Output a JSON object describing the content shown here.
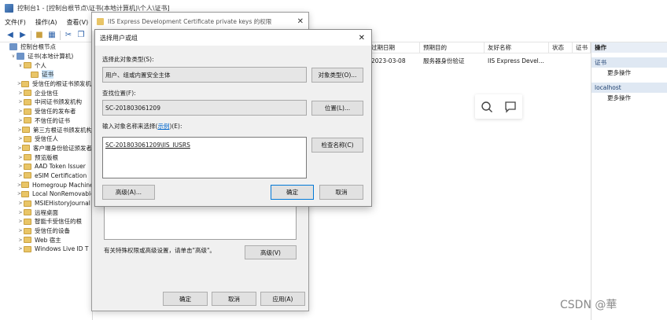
{
  "mmc": {
    "title": "控制台1 - [控制台根节点\\证书(本地计算机)\\个人\\证书]",
    "menu": [
      "文件(F)",
      "操作(A)",
      "查看(V)"
    ],
    "tree": [
      {
        "label": "控制台根节点",
        "indent": 0,
        "icon": "root",
        "exp": ""
      },
      {
        "label": "证书(本地计算机)",
        "indent": 1,
        "icon": "root",
        "exp": "∨"
      },
      {
        "label": "个人",
        "indent": 2,
        "icon": "folder",
        "exp": "∨"
      },
      {
        "label": "证书",
        "indent": 3,
        "icon": "folder",
        "exp": "",
        "selected": true
      },
      {
        "label": "受信任的根证书颁发机构",
        "indent": 2,
        "icon": "folder",
        "exp": ">"
      },
      {
        "label": "企业信任",
        "indent": 2,
        "icon": "folder",
        "exp": ">"
      },
      {
        "label": "中间证书颁发机构",
        "indent": 2,
        "icon": "folder",
        "exp": ">"
      },
      {
        "label": "受信任的发布者",
        "indent": 2,
        "icon": "folder",
        "exp": ">"
      },
      {
        "label": "不信任的证书",
        "indent": 2,
        "icon": "folder",
        "exp": ">"
      },
      {
        "label": "第三方根证书颁发机构",
        "indent": 2,
        "icon": "folder",
        "exp": ">"
      },
      {
        "label": "受信任人",
        "indent": 2,
        "icon": "folder",
        "exp": ">"
      },
      {
        "label": "客户端身份验证颁发者",
        "indent": 2,
        "icon": "folder",
        "exp": ">"
      },
      {
        "label": "预览版根",
        "indent": 2,
        "icon": "folder",
        "exp": ">"
      },
      {
        "label": "AAD Token Issuer",
        "indent": 2,
        "icon": "folder",
        "exp": ">"
      },
      {
        "label": "eSIM Certification",
        "indent": 2,
        "icon": "folder",
        "exp": ">"
      },
      {
        "label": "Homegroup Machine",
        "indent": 2,
        "icon": "folder",
        "exp": ">"
      },
      {
        "label": "Local NonRemovable",
        "indent": 2,
        "icon": "folder",
        "exp": ">"
      },
      {
        "label": "MSIEHistoryJournal",
        "indent": 2,
        "icon": "folder",
        "exp": ">"
      },
      {
        "label": "远程桌面",
        "indent": 2,
        "icon": "folder",
        "exp": ">"
      },
      {
        "label": "智能卡受信任的根",
        "indent": 2,
        "icon": "folder",
        "exp": ">"
      },
      {
        "label": "受信任的设备",
        "indent": 2,
        "icon": "folder",
        "exp": ">"
      },
      {
        "label": "Web 宿主",
        "indent": 2,
        "icon": "folder",
        "exp": ">"
      },
      {
        "label": "Windows Live ID T",
        "indent": 2,
        "icon": "folder",
        "exp": ">"
      }
    ],
    "list": {
      "columns": [
        "过期日期",
        "预期目的",
        "友好名称",
        "状态",
        "证书"
      ],
      "row": [
        "2023-03-08",
        "服务器身份验证",
        "IIS Express Devel...",
        "",
        ""
      ]
    },
    "actions": {
      "header": "操作",
      "group1": "证书",
      "item1": "更多操作",
      "group2": "localhost",
      "item2": "更多操作"
    },
    "watermark": "CSDN @華"
  },
  "perm_dialog": {
    "title": "IIS Express Development Certificate private keys 的权限",
    "hint": "有关特殊权限或高级设置，请单击\"高级\"。",
    "advanced_button": "高级(V)",
    "ok_button": "确定",
    "cancel_button": "取消",
    "apply_button": "应用(A)"
  },
  "select_dialog": {
    "title": "选择用户或组",
    "object_type_label": "选择此对象类型(S):",
    "object_type_value": "用户、组或内置安全主体",
    "object_type_button": "对象类型(O)...",
    "location_label": "查找位置(F):",
    "location_value": "SC-201803061209",
    "location_button": "位置(L)...",
    "names_label_prefix": "输入对象名称来选择(",
    "names_label_link": "示例",
    "names_label_suffix": ")(E):",
    "names_value": "SC-201803061209\\IIS_IUSRS",
    "check_names_button": "检查名称(C)",
    "advanced_button": "高级(A)...",
    "ok_button": "确定",
    "cancel_button": "取消"
  }
}
